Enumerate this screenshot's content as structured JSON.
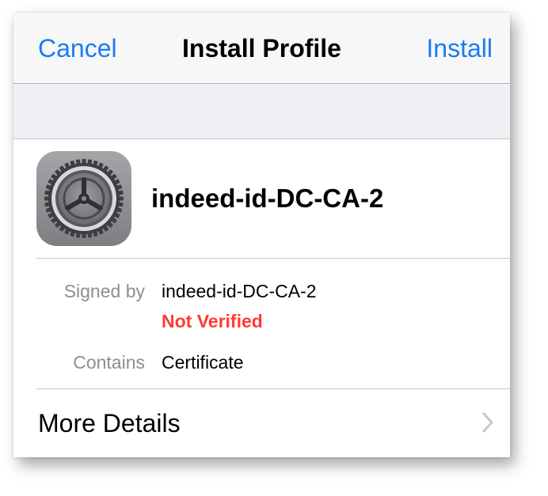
{
  "navbar": {
    "cancel_label": "Cancel",
    "title": "Install Profile",
    "install_label": "Install"
  },
  "profile": {
    "name": "indeed-id-DC-CA-2",
    "icon": "settings-gear-icon"
  },
  "details": {
    "signed_by_label": "Signed by",
    "signed_by_value": "indeed-id-DC-CA-2",
    "verification_status": "Not Verified",
    "contains_label": "Contains",
    "contains_value": "Certificate"
  },
  "more_details": {
    "label": "More Details",
    "icon": "chevron-right-icon"
  },
  "colors": {
    "accent": "#1a7cf4",
    "warning": "#ff3b30",
    "secondary_text": "#8e8e93",
    "grouped_background": "#efeff4"
  }
}
